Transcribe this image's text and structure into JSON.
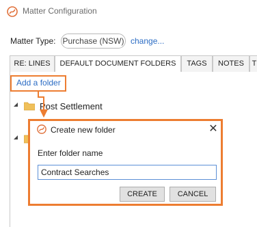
{
  "window": {
    "title": "Matter Configuration"
  },
  "matter": {
    "type_label": "Matter Type:",
    "type_value": "Purchase (NSW)",
    "change_link": "change..."
  },
  "tabs": [
    "RE: LINES",
    "DEFAULT DOCUMENT FOLDERS",
    "TAGS",
    "NOTES",
    "T"
  ],
  "active_tab": "DEFAULT DOCUMENT FOLDERS",
  "toolbar": {
    "add_folder": "Add a folder"
  },
  "tree": {
    "items": [
      {
        "label": "Post Settlement"
      }
    ]
  },
  "dialog": {
    "title": "Create new folder",
    "close_glyph": "✕",
    "prompt": "Enter folder name",
    "input_value": "Contract Searches",
    "create_label": "CREATE",
    "cancel_label": "CANCEL"
  },
  "colors": {
    "highlight": "#ed7d31",
    "link": "#2b6cc4",
    "folder": "#f0c05a"
  },
  "icons": {
    "app_logo": "app-logo-icon",
    "folder": "folder-icon",
    "close": "close-icon"
  }
}
